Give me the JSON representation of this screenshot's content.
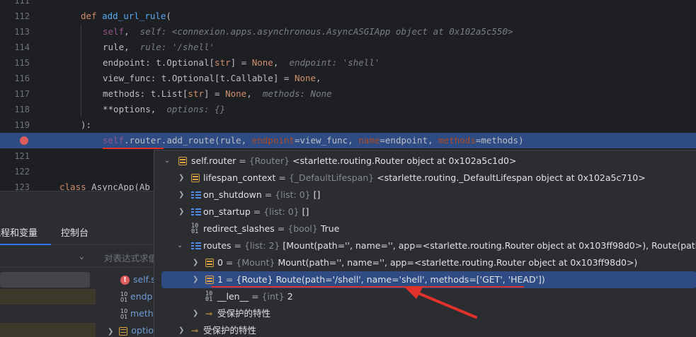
{
  "editor": {
    "lines": [
      {
        "num": "111"
      },
      {
        "num": "112"
      },
      {
        "num": "113"
      },
      {
        "num": "114"
      },
      {
        "num": "115"
      },
      {
        "num": "116"
      },
      {
        "num": "117"
      },
      {
        "num": "118"
      },
      {
        "num": "119"
      },
      {
        "num": "",
        "breakpoint": true
      },
      {
        "num": "121"
      },
      {
        "num": "122"
      },
      {
        "num": "123"
      }
    ],
    "code": {
      "l112_def": "def",
      "l112_fn": "add_url_rule",
      "l112_rest": "(",
      "l113_self": "self",
      "l113_comma": ",",
      "l113_hint": "self: <connexion.apps.asynchronous.AsyncASGIApp object at 0x102a5c550>",
      "l114_code": "rule,",
      "l114_hint": "rule: '/shell'",
      "l115_code_a": "endpoint: t.Optional[",
      "l115_kw": "str",
      "l115_code_b": "] = ",
      "l115_none": "None",
      "l115_comma": ",",
      "l115_hint": "endpoint: 'shell'",
      "l116_code_a": "view_func: t.Optional[t.Callable] = ",
      "l116_none": "None",
      "l116_comma": ",",
      "l117_code_a": "methods: t.List[",
      "l117_kw": "str",
      "l117_code_b": "] = ",
      "l117_none": "None",
      "l117_comma": ",",
      "l117_hint": "methods: None",
      "l118_code": "**options,",
      "l118_hint": "options: {}",
      "l119_code": "):",
      "l120_self": "self",
      "l120_a": ".router",
      "l120_b": ".add_route(rule, ",
      "l120_p1": "endpoint",
      "l120_c": "=view_func, ",
      "l120_p2": "name",
      "l120_d": "=endpoint, ",
      "l120_p3": "methods",
      "l120_e": "=methods)",
      "l123_kw": "class",
      "l123_rest": " AsyncApp(Ab"
    }
  },
  "panel": {
    "tabs": [
      {
        "label": "线程和变量",
        "active": true
      },
      {
        "label": "控制台",
        "active": false
      }
    ],
    "expr_placeholder": "对表达式求值",
    "right_vars": [
      {
        "label": "self.s",
        "icon": "error-icon"
      },
      {
        "label": "endp",
        "icon": "number-icon"
      },
      {
        "label": "meth",
        "icon": "number-icon"
      },
      {
        "label": "optio",
        "icon": "object-icon"
      }
    ]
  },
  "debugger": {
    "rows": [
      {
        "name": "self.router",
        "type": "{Router}",
        "value": "<starlette.routing.Router object at 0x102a5c1d0>",
        "icon": "object-icon",
        "expanded": true
      },
      {
        "name": "lifespan_context",
        "type": "{_DefaultLifespan}",
        "value": "<starlette.routing._DefaultLifespan object at 0x102a5c710>",
        "icon": "object-icon"
      },
      {
        "name": "on_shutdown",
        "type": "{list: 0}",
        "value": "[]",
        "icon": "list-icon"
      },
      {
        "name": "on_startup",
        "type": "{list: 0}",
        "value": "[]",
        "icon": "list-icon"
      },
      {
        "name": "redirect_slashes",
        "type": "{bool}",
        "value": "True",
        "icon": "number-icon"
      },
      {
        "name": "routes",
        "type": "{list: 2}",
        "value": "[Mount(path='', name='', app=<starlette.routing.Router object at 0x103ff98d0>), Route(path='/shel",
        "icon": "list-icon",
        "expanded": true
      },
      {
        "name": "0",
        "type": "{Mount}",
        "value": "Mount(path='', name='', app=<starlette.routing.Router object at 0x103ff98d0>)",
        "icon": "object-icon"
      },
      {
        "name": "1",
        "type": "{Route}",
        "value": "Route(path='/shell', name='shell', methods=['GET', 'HEAD'])",
        "icon": "object-icon",
        "selected": true
      },
      {
        "name": "__len__",
        "type": "{int}",
        "value": "2",
        "icon": "number-icon"
      },
      {
        "name": "受保护的特性",
        "icon": "key-icon"
      },
      {
        "name": "受保护的特性",
        "icon": "key-icon"
      }
    ]
  },
  "colors": {
    "accent": "#3574f0",
    "execution_line": "#2e4c83",
    "annotation_red": "#e0312b",
    "breakpoint": "#db5c5c"
  }
}
